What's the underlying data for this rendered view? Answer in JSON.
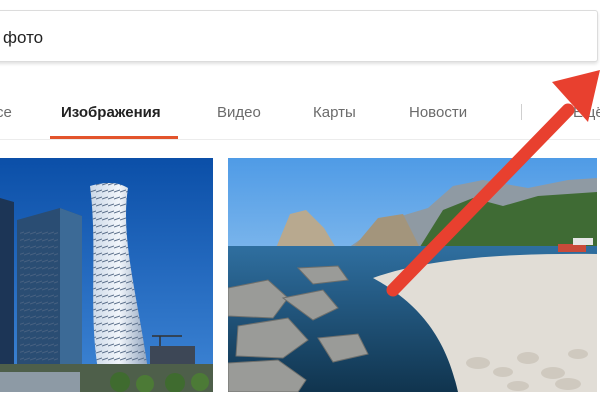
{
  "search": {
    "value": "фото"
  },
  "tabs": [
    {
      "label": "Все"
    },
    {
      "label": "Изображения"
    },
    {
      "label": "Видео"
    },
    {
      "label": "Карты"
    },
    {
      "label": "Новости"
    },
    {
      "label": "Ещё"
    }
  ],
  "colors": {
    "active_tab_underline": "#e3542c",
    "annotation_arrow": "#e8402f"
  },
  "results": {
    "image_1": "skyscrapers-city-photo",
    "image_2": "seaside-rocky-beach-photo"
  },
  "annotation": {
    "icon": "red-arrow"
  }
}
